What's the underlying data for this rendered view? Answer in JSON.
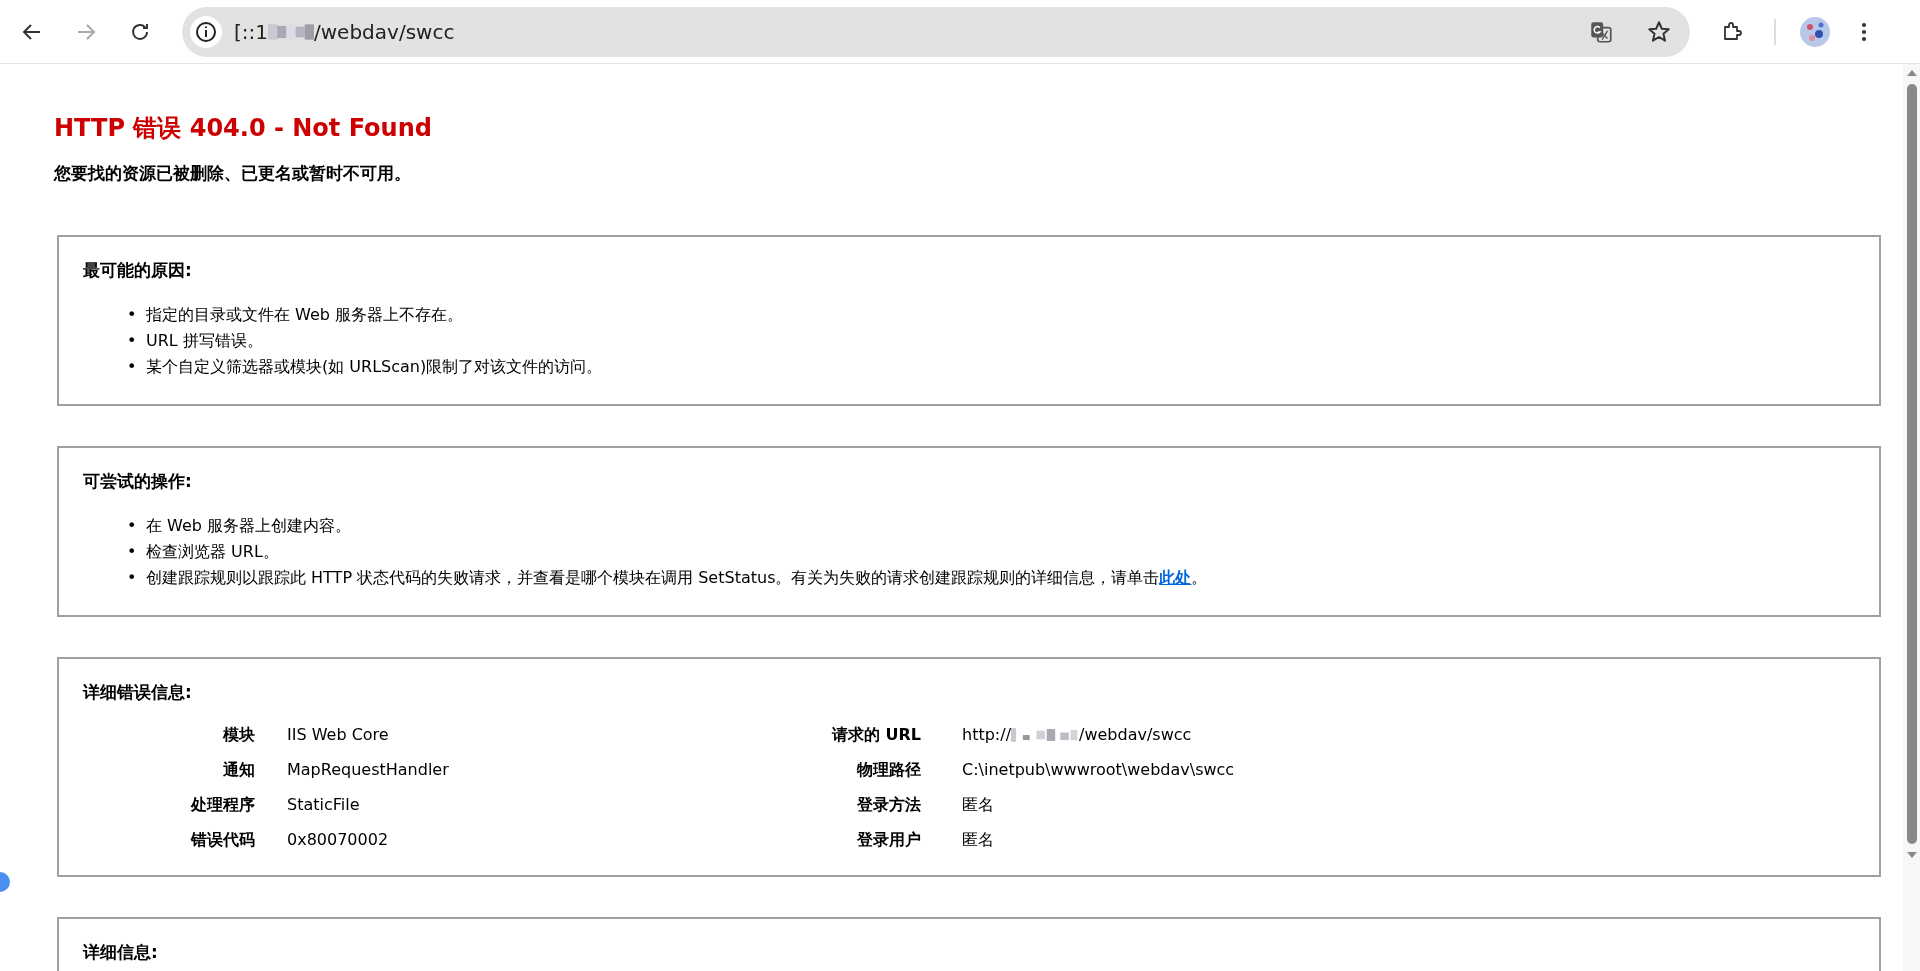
{
  "browser": {
    "url_prefix": "[::1",
    "url_suffix": "/webdav/swcc"
  },
  "page": {
    "title": "HTTP 错误 404.0 - Not Found",
    "subtitle": "您要找的资源已被删除、已更名或暂时不可用。",
    "sections": [
      {
        "kind": "list",
        "heading": "最可能的原因:",
        "items": [
          {
            "marker": "•",
            "text": "指定的目录或文件在 Web 服务器上不存在。"
          },
          {
            "marker": "•",
            "text": "URL 拼写错误。"
          },
          {
            "marker": "•",
            "text": "某个自定义筛选器或模块(如 URLScan)限制了对该文件的访问。"
          }
        ]
      },
      {
        "kind": "list",
        "heading": "可尝试的操作:",
        "items": [
          {
            "marker": "•",
            "text": "在 Web 服务器上创建内容。"
          },
          {
            "marker": "•",
            "text": "检查浏览器 URL。"
          },
          {
            "marker": "•",
            "text": "创建跟踪规则以跟踪此 HTTP 状态代码的失败请求，并查看是哪个模块在调用 SetStatus。有关为失败的请求创建跟踪规则的详细信息，请单击",
            "link": "此处",
            "after": "。"
          }
        ]
      },
      {
        "kind": "details",
        "heading": "详细错误信息:",
        "left": [
          {
            "label": "模块",
            "value": "IIS Web Core"
          },
          {
            "label": "通知",
            "value": "MapRequestHandler"
          },
          {
            "label": "处理程序",
            "value": "StaticFile"
          },
          {
            "label": "错误代码",
            "value": "0x80070002"
          }
        ],
        "right": [
          {
            "label": "请求的 URL",
            "value": "http://",
            "value_suffix": "/webdav/swcc"
          },
          {
            "label": "物理路径",
            "value": "C:\\inetpub\\wwwroot\\webdav\\swcc"
          },
          {
            "label": "登录方法",
            "value": "匿名"
          },
          {
            "label": "登录用户",
            "value": "匿名"
          }
        ]
      },
      {
        "kind": "list",
        "heading": "详细信息:"
      }
    ]
  }
}
